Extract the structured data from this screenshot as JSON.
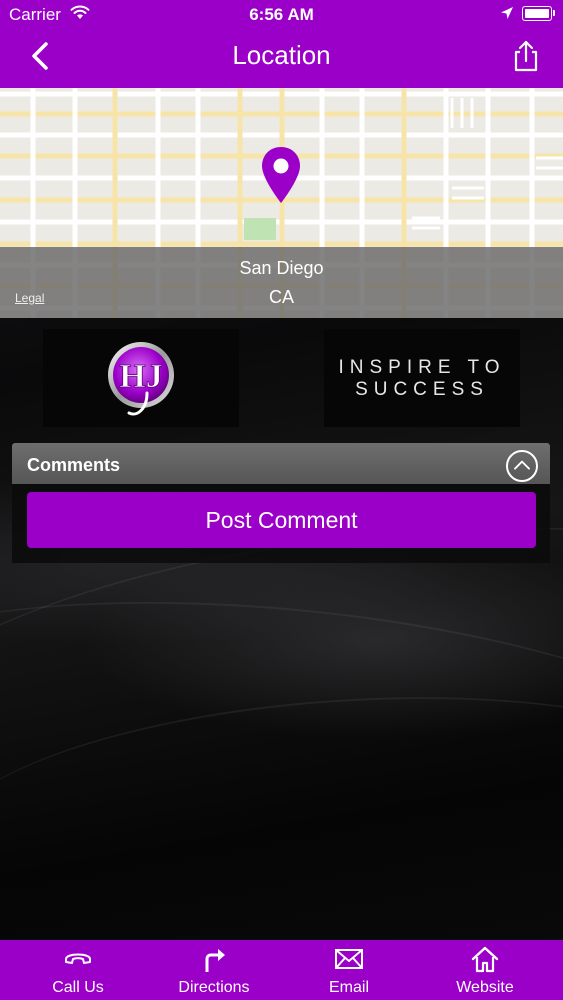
{
  "status_bar": {
    "carrier": "Carrier",
    "time": "6:56 AM",
    "icons": [
      "wifi-icon",
      "location-arrow-icon",
      "battery-icon"
    ]
  },
  "nav": {
    "title": "Location",
    "back_icon": "chevron-left-icon",
    "share_icon": "share-icon"
  },
  "map": {
    "city": "San Diego",
    "state": "CA",
    "legal_label": "Legal",
    "pin_color": "#9b00c8"
  },
  "logos": {
    "left_logo": "HJ",
    "right_logo_line1": "INSPIRE TO",
    "right_logo_line2": "SUCCESS"
  },
  "comments": {
    "header": "Comments",
    "post_button": "Post Comment",
    "collapse_icon": "chevron-up-circle-icon"
  },
  "tabbar": {
    "items": [
      {
        "label": "Call Us",
        "icon": "phone-icon"
      },
      {
        "label": "Directions",
        "icon": "directions-arrow-icon"
      },
      {
        "label": "Email",
        "icon": "envelope-icon"
      },
      {
        "label": "Website",
        "icon": "home-icon"
      }
    ]
  },
  "colors": {
    "accent": "#9b00c8",
    "background": "#0a0a0a",
    "comments_header": "#606060"
  }
}
